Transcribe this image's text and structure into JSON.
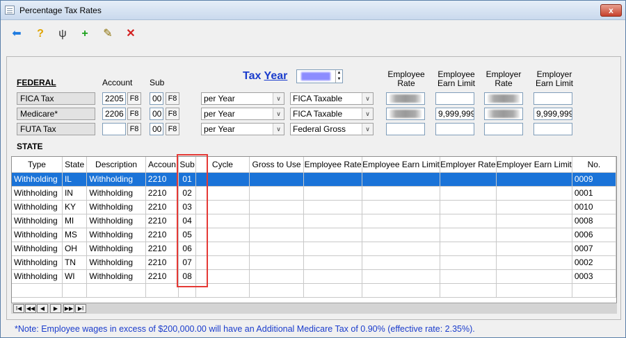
{
  "window": {
    "title": "Percentage Tax Rates",
    "close_label": "x"
  },
  "toolbar": {
    "back_glyph": "⬅",
    "help_glyph": "?",
    "tool_glyph": "ψ",
    "add_glyph": "+",
    "edit_glyph": "✎",
    "delete_glyph": "✕"
  },
  "federal": {
    "heading": "FEDERAL",
    "account_label": "Account",
    "sub_label": "Sub",
    "tax_year_label_prefix": "Tax ",
    "tax_year_label_underlined": "Year",
    "emp_rate_label_1": "Employee",
    "emp_rate_label_2": "Rate",
    "emp_limit_label_1": "Employee",
    "emp_limit_label_2": "Earn Limit",
    "er_rate_label_1": "Employer",
    "er_rate_label_2": "Rate",
    "er_limit_label_1": "Employer",
    "er_limit_label_2": "Earn Limit",
    "f8": "F8",
    "rows": [
      {
        "name": "FICA Tax",
        "account": "2205",
        "sub": "00",
        "cycle": "per Year",
        "basis": "FICA Taxable",
        "emp_limit": "",
        "er_limit": ""
      },
      {
        "name": "Medicare*",
        "account": "2206",
        "sub": "00",
        "cycle": "per Year",
        "basis": "FICA Taxable",
        "emp_limit": "9,999,999",
        "er_limit": "9,999,999"
      },
      {
        "name": "FUTA Tax",
        "account": "",
        "sub": "00",
        "cycle": "per Year",
        "basis": "Federal Gross",
        "emp_limit": "",
        "er_limit": ""
      }
    ]
  },
  "state": {
    "heading": "STATE",
    "columns": [
      "Type",
      "State",
      "Description",
      "Accoun",
      "Sub",
      "Cycle",
      "Gross to Use",
      "Employee Rate",
      "Employee Earn Limit",
      "Employer Rate",
      "Employer Earn Limit",
      "No."
    ],
    "rows": [
      {
        "type": "Withholding",
        "state": "IL",
        "description": "Withholding",
        "account": "2210",
        "sub": "01",
        "no": "0009"
      },
      {
        "type": "Withholding",
        "state": "IN",
        "description": "Withholding",
        "account": "2210",
        "sub": "02",
        "no": "0001"
      },
      {
        "type": "Withholding",
        "state": "KY",
        "description": "Withholding",
        "account": "2210",
        "sub": "03",
        "no": "0010"
      },
      {
        "type": "Withholding",
        "state": "MI",
        "description": "Withholding",
        "account": "2210",
        "sub": "04",
        "no": "0008"
      },
      {
        "type": "Withholding",
        "state": "MS",
        "description": "Withholding",
        "account": "2210",
        "sub": "05",
        "no": "0006"
      },
      {
        "type": "Withholding",
        "state": "OH",
        "description": "Withholding",
        "account": "2210",
        "sub": "06",
        "no": "0007"
      },
      {
        "type": "Withholding",
        "state": "TN",
        "description": "Withholding",
        "account": "2210",
        "sub": "07",
        "no": "0002"
      },
      {
        "type": "Withholding",
        "state": "WI",
        "description": "Withholding",
        "account": "2210",
        "sub": "08",
        "no": "0003"
      }
    ],
    "nav": [
      "I◀",
      "◀◀",
      "◀",
      "▶",
      "▶▶",
      "▶I"
    ]
  },
  "footer": {
    "note": "*Note: Employee wages in excess of $200,000.00 will have an Additional Medicare Tax of 0.90% (effective rate: 2.35%)."
  },
  "colors": {
    "accent": "#1a73d8",
    "tax_year": "#1a3ccc",
    "highlight": "#e53935"
  }
}
